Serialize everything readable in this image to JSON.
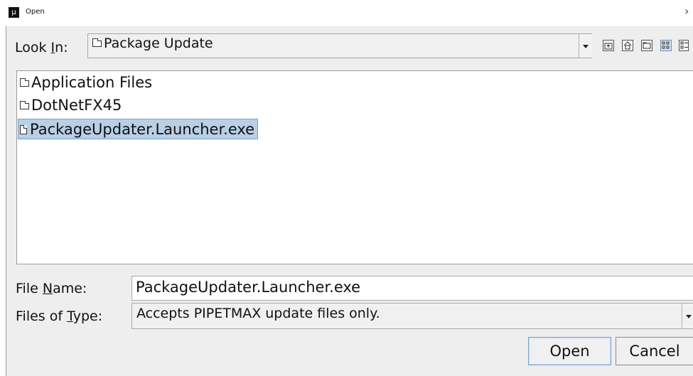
{
  "window": {
    "title": "Open",
    "app_icon_glyph": "µ",
    "close_glyph": "›"
  },
  "look_in": {
    "label_pre": "Look ",
    "label_mnemonic": "I",
    "label_post": "n:",
    "value": "Package Update"
  },
  "toolbar": {
    "icons": [
      "up-one-level-icon",
      "home-icon",
      "new-folder-icon",
      "list-view-icon",
      "details-view-icon"
    ]
  },
  "files": [
    {
      "name": "Application Files",
      "type": "folder"
    },
    {
      "name": "DotNetFX45",
      "type": "folder"
    },
    {
      "name": "PackageUpdater.Launcher.exe",
      "type": "file",
      "selected": true
    }
  ],
  "file_name": {
    "label_pre": "File ",
    "label_mnemonic": "N",
    "label_post": "ame:",
    "value": "PackageUpdater.Launcher.exe"
  },
  "file_type": {
    "label_pre": "Files of ",
    "label_mnemonic": "T",
    "label_post": "ype:",
    "value": "Accepts PIPETMAX update files only."
  },
  "buttons": {
    "open": "Open",
    "cancel": "Cancel"
  },
  "colors": {
    "selection": "#b8cfe5",
    "dialog_bg": "#eeeeee"
  }
}
